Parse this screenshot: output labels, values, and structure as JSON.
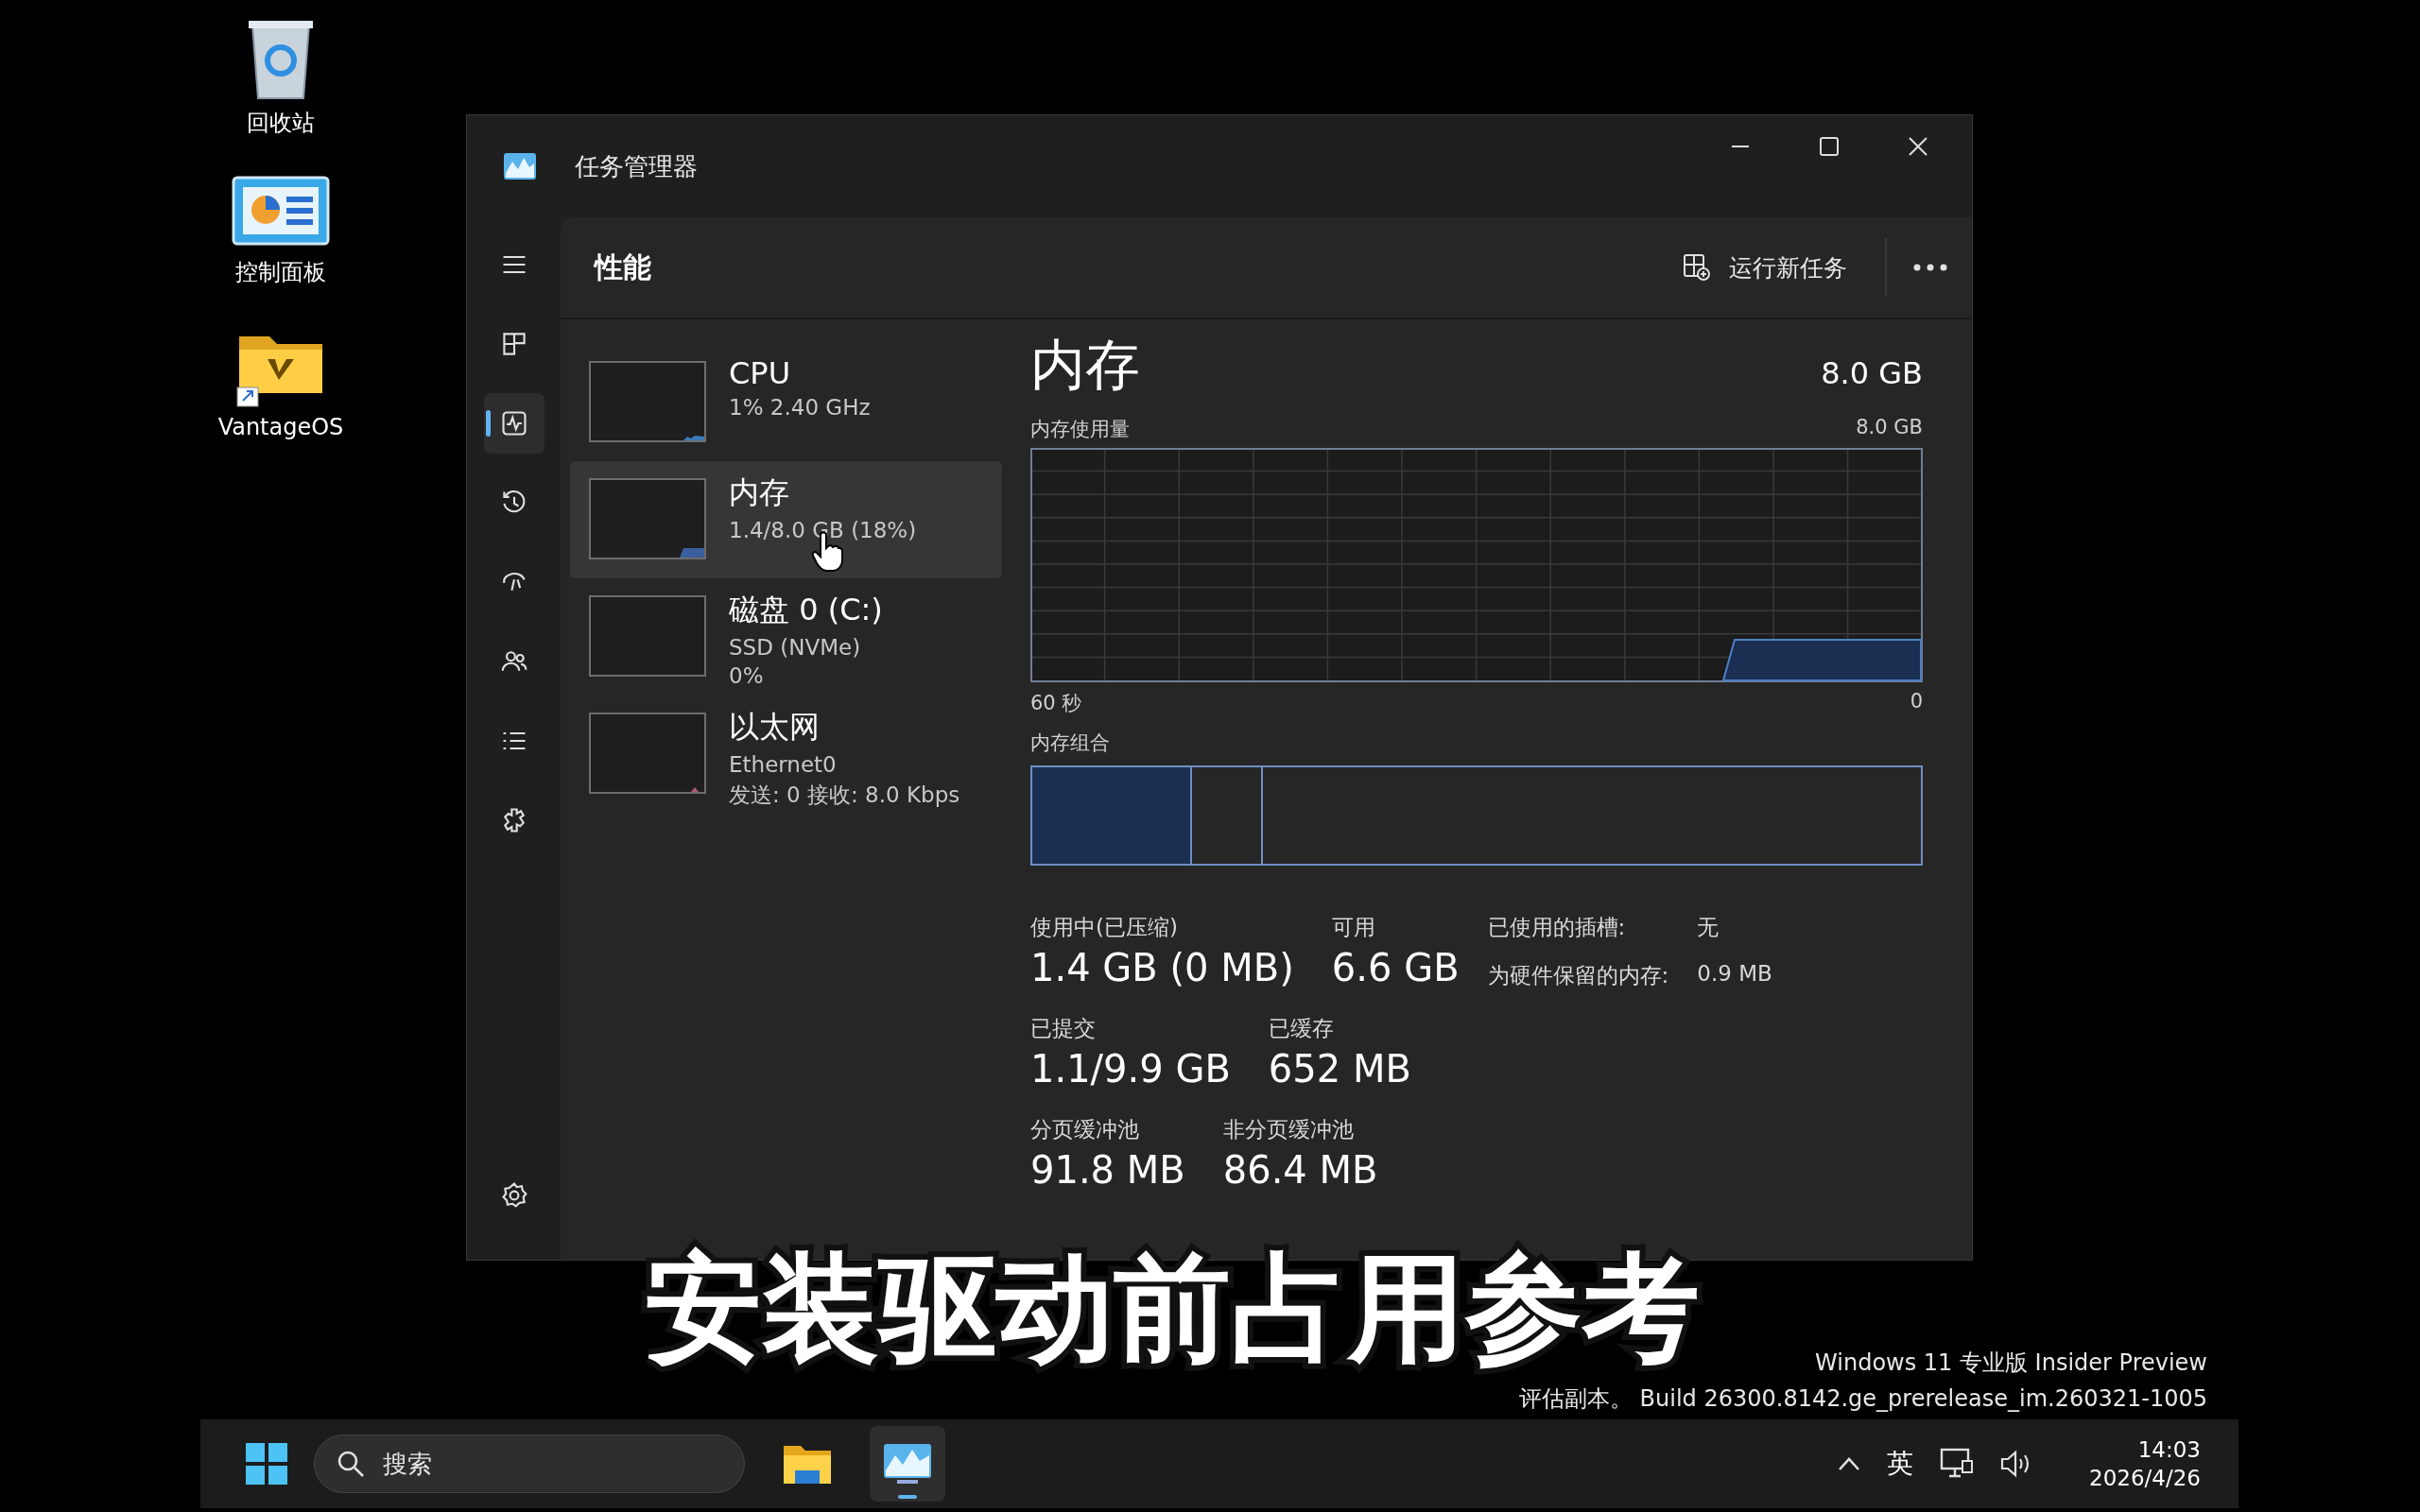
{
  "desktop_icons": [
    {
      "label": "回收站",
      "kind": "recycle-bin"
    },
    {
      "label": "控制面板",
      "kind": "control-panel"
    },
    {
      "label": "VantageOS",
      "kind": "folder"
    }
  ],
  "window": {
    "title": "任务管理器"
  },
  "nav_items": [
    {
      "kind": "menu",
      "selected": false
    },
    {
      "kind": "processes",
      "selected": false
    },
    {
      "kind": "performance",
      "selected": true
    },
    {
      "kind": "history",
      "selected": false
    },
    {
      "kind": "startup",
      "selected": false
    },
    {
      "kind": "users",
      "selected": false
    },
    {
      "kind": "details",
      "selected": false
    },
    {
      "kind": "services",
      "selected": false
    },
    {
      "kind": "settings",
      "selected": false
    }
  ],
  "page_title": "性能",
  "run_task_label": "运行新任务",
  "resources": [
    {
      "name": "CPU",
      "details": [
        "1% 2.40 GHz"
      ],
      "selected": false,
      "kind": "cpu"
    },
    {
      "name": "内存",
      "details": [
        "1.4/8.0 GB (18%)"
      ],
      "selected": true,
      "kind": "memory"
    },
    {
      "name": "磁盘 0 (C:)",
      "details": [
        "SSD (NVMe)",
        "0%"
      ],
      "selected": false,
      "kind": "disk"
    },
    {
      "name": "以太网",
      "details": [
        "Ethernet0",
        "发送: 0 接收: 8.0 Kbps"
      ],
      "selected": false,
      "kind": "network"
    }
  ],
  "detail": {
    "title": "内存",
    "total": "8.0 GB",
    "graph_label": "内存使用量",
    "graph_max": "8.0 GB",
    "graph_start": "60 秒",
    "graph_end": "0",
    "composition_label": "内存组合",
    "composition": [
      {
        "kind": "in-use",
        "level": 0.18
      }
    ],
    "stats": [
      [
        {
          "label": "使用中(已压缩)",
          "value": "1.4 GB (0 MB)"
        },
        {
          "label": "可用",
          "value": "6.6 GB"
        }
      ],
      [
        {
          "label": "已提交",
          "value": "1.1/9.9 GB"
        },
        {
          "label": "已缓存",
          "value": "652 MB"
        }
      ],
      [
        {
          "label": "分页缓冲池",
          "value": "91.8 MB"
        },
        {
          "label": "非分页缓冲池",
          "value": "86.4 MB"
        }
      ]
    ],
    "properties": [
      {
        "label": "已使用的插槽:",
        "value": "无"
      },
      {
        "label": "为硬件保留的内存:",
        "value": "0.9 MB"
      }
    ]
  },
  "caption": "安装驱动前占用参考",
  "os_notice": [
    "Windows 11 专业版 Insider Preview",
    "评估副本。 Build 26300.8142.ge_prerelease_im.260321-1005"
  ],
  "taskbar": {
    "search_placeholder": "搜索",
    "apps": [
      {
        "kind": "explorer",
        "active": false
      },
      {
        "kind": "task-manager",
        "active": true
      }
    ],
    "input_method": "英",
    "time": "14:03",
    "date": "2026/4/26"
  }
}
